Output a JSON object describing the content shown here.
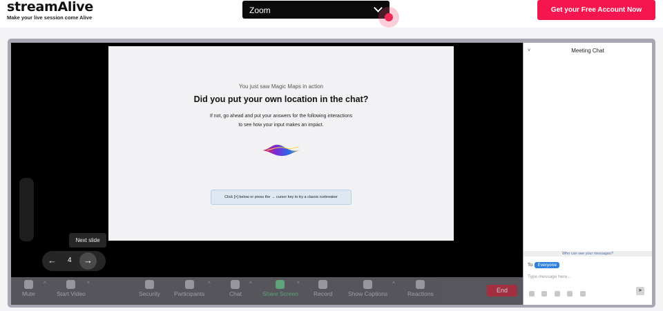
{
  "header": {
    "logo": "streamAlive",
    "tagline": "Make your live session come Alive",
    "platform_select": "Zoom",
    "cta_label": "Get your Free Account Now"
  },
  "slide": {
    "kicker": "You just saw Magic Maps in action",
    "title": "Did you put your own location in the chat?",
    "body_line1": "If not, go ahead and put your answers for the following interactions",
    "body_line2": "to see how your input makes an impact.",
    "cta_text": "Click [>] below or press the → cursor key to try a classic icebreaker"
  },
  "slide_nav": {
    "tooltip": "Next slide",
    "page": "4",
    "prev_glyph": "←",
    "next_glyph": "→"
  },
  "toolbar": {
    "items": [
      "Mute",
      "Start Video",
      "Security",
      "Participants",
      "Chat",
      "Share Screen",
      "Record",
      "Show Captions",
      "Reactions"
    ],
    "end_label": "End"
  },
  "chat": {
    "title": "Meeting Chat",
    "collapse_glyph": "˅",
    "who_can_see": "Who can see your messages?",
    "to_label": "To:",
    "recipient": "Everyone",
    "input_placeholder": "Type message here...",
    "send_glyph": "➤"
  },
  "colors": {
    "cta": "#f5164f",
    "frame": "#a7a6b3",
    "share_screen": "#23a14d",
    "end": "#c11f33",
    "recipient_badge": "#2f7fe0"
  }
}
